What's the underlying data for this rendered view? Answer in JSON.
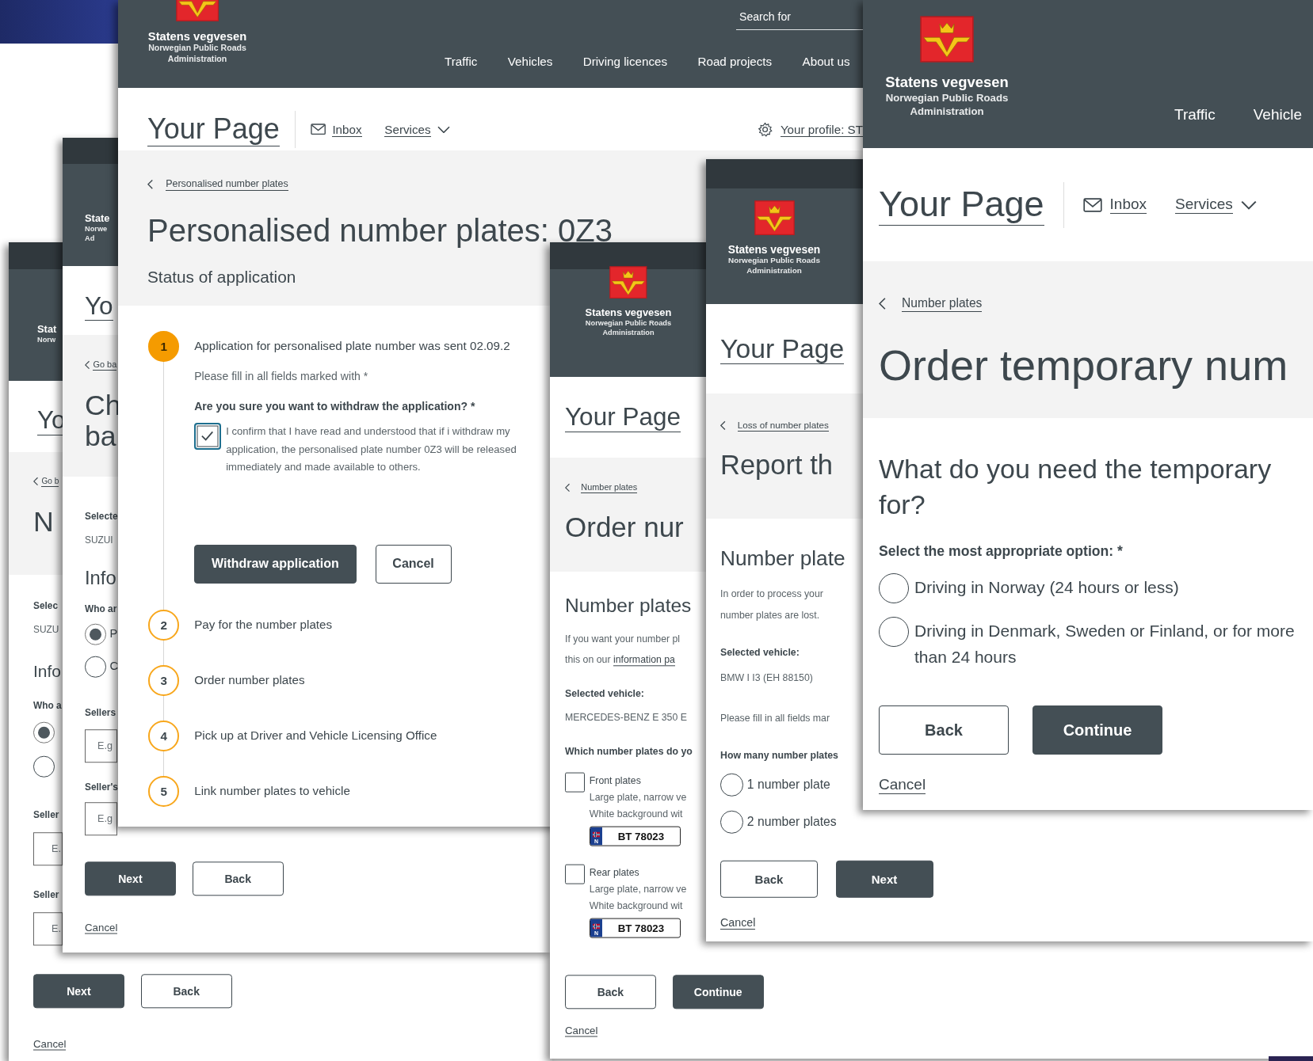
{
  "windows": [
    {
      "header": {
        "logo": {
          "emblem_visible": false,
          "title": "Stat",
          "subtitle_lines": [
            "Norw"
          ]
        }
      },
      "top_bar": {
        "title": "Yo"
      },
      "hero": {
        "back_link": "Go b",
        "title_lines": [
          "N"
        ]
      },
      "body": [
        {
          "kind": "label",
          "text": "Selec"
        },
        {
          "kind": "value",
          "text": "SUZU"
        },
        {
          "kind": "heading",
          "lines": [
            "Info"
          ]
        },
        {
          "kind": "label",
          "text": "Who a"
        },
        {
          "kind": "radio",
          "selected": true
        },
        {
          "kind": "radio",
          "selected": false
        },
        {
          "kind": "label",
          "text": "Seller"
        },
        {
          "kind": "field",
          "placeholder": "E."
        },
        {
          "kind": "label",
          "text": "Seller"
        },
        {
          "kind": "field",
          "placeholder": "E."
        },
        {
          "kind": "buttons",
          "buttons": [
            {
              "label": "Next",
              "kind": "primary"
            },
            {
              "label": "Back",
              "kind": "secondary"
            }
          ]
        },
        {
          "kind": "link",
          "text": "Cancel"
        }
      ]
    },
    {
      "header": {
        "logo": {
          "emblem_visible": false,
          "title": "State",
          "subtitle_lines": [
            "Norwe",
            "Ad"
          ]
        }
      },
      "top_bar": {
        "title": "Yo"
      },
      "hero": {
        "back_link": "Go ba",
        "title_lines": [
          "Ch",
          "ba"
        ]
      },
      "body": [
        {
          "kind": "label",
          "text": "Selecte"
        },
        {
          "kind": "value",
          "text": "SUZUI"
        },
        {
          "kind": "heading",
          "lines": [
            "Info"
          ]
        },
        {
          "kind": "label",
          "text": "Who ar"
        },
        {
          "kind": "radio",
          "selected": true,
          "label": "P"
        },
        {
          "kind": "radio",
          "selected": false,
          "label": "C"
        },
        {
          "kind": "label",
          "text": "Sellers"
        },
        {
          "kind": "field",
          "placeholder": "E.g"
        },
        {
          "kind": "label",
          "text": "Seller's"
        },
        {
          "kind": "field",
          "placeholder": "E.g"
        },
        {
          "kind": "buttons",
          "buttons": [
            {
              "label": "Next",
              "kind": "primary"
            },
            {
              "label": "Back",
              "kind": "secondary"
            }
          ]
        },
        {
          "kind": "link",
          "text": "Cancel"
        }
      ]
    },
    {
      "header": {
        "logo": {
          "emblem_visible": true,
          "title": "Statens vegvesen",
          "subtitle_lines": [
            "Norwegian Public Roads",
            "Administration"
          ]
        },
        "search": {
          "placeholder": "Search for"
        },
        "nav": [
          "Traffic",
          "Vehicles",
          "Driving licences",
          "Road projects",
          "About us"
        ]
      },
      "top_bar": {
        "title": "Your Page",
        "inbox": "Inbox",
        "services": "Services",
        "profile": "Your profile: ST"
      },
      "hero": {
        "back_link": "Personalised number plates",
        "title_lines": [
          "Personalised number plates: 0Z3"
        ],
        "subtitle": "Status of application"
      },
      "body": [
        {
          "kind": "stepper",
          "steps": [
            {
              "number": "1",
              "active": true,
              "text": "Application for personalised plate number was sent 02.09.2",
              "content": [
                {
                  "kind": "text",
                  "text": "Please fill in all fields marked with *"
                },
                {
                  "kind": "label",
                  "text": "Are you sure you want to withdraw the application? *"
                },
                {
                  "kind": "checkbox",
                  "checked": true,
                  "label": "I confirm that I have read and understood that if i withdraw my application, the personalised plate number 0Z3 will be released immediately and made available to others."
                },
                {
                  "kind": "buttons",
                  "buttons": [
                    {
                      "label": "Withdraw application",
                      "kind": "primary"
                    },
                    {
                      "label": "Cancel",
                      "kind": "secondary"
                    }
                  ]
                }
              ]
            },
            {
              "number": "2",
              "active": false,
              "text": "Pay for the number plates"
            },
            {
              "number": "3",
              "active": false,
              "text": "Order number plates"
            },
            {
              "number": "4",
              "active": false,
              "text": "Pick up at Driver and Vehicle Licensing Office"
            },
            {
              "number": "5",
              "active": false,
              "text": "Link number plates to vehicle"
            }
          ]
        }
      ]
    },
    {
      "header": {
        "logo": {
          "emblem_visible": true,
          "title": "Statens vegvesen",
          "subtitle_lines": [
            "Norwegian Public Roads",
            "Administration"
          ]
        }
      },
      "top_bar": {
        "title": "Your Page"
      },
      "hero": {
        "back_link": "Number plates",
        "title_lines": [
          "Order nur"
        ]
      },
      "body": [
        {
          "kind": "heading",
          "lines": [
            "Number plates"
          ]
        },
        {
          "kind": "text",
          "text": "If you want your number pl"
        },
        {
          "kind": "text",
          "text": "this on our",
          "link": "information pa"
        },
        {
          "kind": "label",
          "text": "Selected vehicle:"
        },
        {
          "kind": "value",
          "text": "MERCEDES-BENZ E 350 E"
        },
        {
          "kind": "label",
          "text": "Which number plates do yo"
        },
        {
          "kind": "checkbox",
          "checked": false,
          "label": "Front plates",
          "details": [
            "Large plate, narrow ve",
            "White background wit"
          ],
          "plate": {
            "country": "N",
            "number": "BT 78023"
          }
        },
        {
          "kind": "checkbox",
          "checked": false,
          "label": "Rear plates",
          "details": [
            "Large plate, narrow ve",
            "White background wit"
          ],
          "plate": {
            "country": "N",
            "number": "BT 78023"
          }
        },
        {
          "kind": "buttons",
          "buttons": [
            {
              "label": "Back",
              "kind": "secondary"
            },
            {
              "label": "Continue",
              "kind": "primary"
            }
          ]
        },
        {
          "kind": "link",
          "text": "Cancel"
        }
      ]
    },
    {
      "header": {
        "logo": {
          "emblem_visible": true,
          "title": "Statens vegvesen",
          "subtitle_lines": [
            "Norwegian Public Roads",
            "Administration"
          ]
        }
      },
      "top_bar": {
        "title": "Your Page"
      },
      "hero": {
        "back_link": "Loss of number plates",
        "title_lines": [
          "Report th"
        ]
      },
      "body": [
        {
          "kind": "heading",
          "lines": [
            "Number plate"
          ]
        },
        {
          "kind": "text",
          "text": "In order to process your"
        },
        {
          "kind": "text",
          "text": "number plates are lost."
        },
        {
          "kind": "label",
          "text": "Selected vehicle:"
        },
        {
          "kind": "value",
          "text": "BMW I I3 (EH 88150)"
        },
        {
          "kind": "text",
          "text": "Please fill in all fields mar"
        },
        {
          "kind": "label",
          "text": "How many number plates"
        },
        {
          "kind": "radio",
          "selected": false,
          "label": "1 number plate"
        },
        {
          "kind": "radio",
          "selected": false,
          "label": "2 number plates"
        },
        {
          "kind": "buttons",
          "buttons": [
            {
              "label": "Back",
              "kind": "secondary"
            },
            {
              "label": "Next",
              "kind": "primary"
            }
          ]
        },
        {
          "kind": "link",
          "text": "Cancel"
        }
      ]
    },
    {
      "header": {
        "logo": {
          "emblem_visible": true,
          "title": "Statens vegvesen",
          "subtitle_lines": [
            "Norwegian Public Roads",
            "Administration"
          ]
        },
        "nav": [
          "Traffic",
          "Vehicle"
        ]
      },
      "top_bar": {
        "title": "Your Page",
        "inbox": "Inbox",
        "services": "Services"
      },
      "hero": {
        "back_link": "Number plates",
        "title_lines": [
          "Order temporary num"
        ]
      },
      "body": [
        {
          "kind": "heading",
          "lines": [
            "What do you need the temporary",
            "for?"
          ]
        },
        {
          "kind": "label",
          "text": "Select the most appropriate option: *"
        },
        {
          "kind": "radio",
          "selected": false,
          "label": "Driving in Norway (24 hours or less)"
        },
        {
          "kind": "radio",
          "selected": false,
          "label": "Driving in Denmark, Sweden or Finland, or for more than 24 hours"
        },
        {
          "kind": "buttons",
          "buttons": [
            {
              "label": "Back",
              "kind": "secondary"
            },
            {
              "label": "Continue",
              "kind": "primary"
            }
          ]
        },
        {
          "kind": "link",
          "text": "Cancel"
        }
      ]
    }
  ]
}
